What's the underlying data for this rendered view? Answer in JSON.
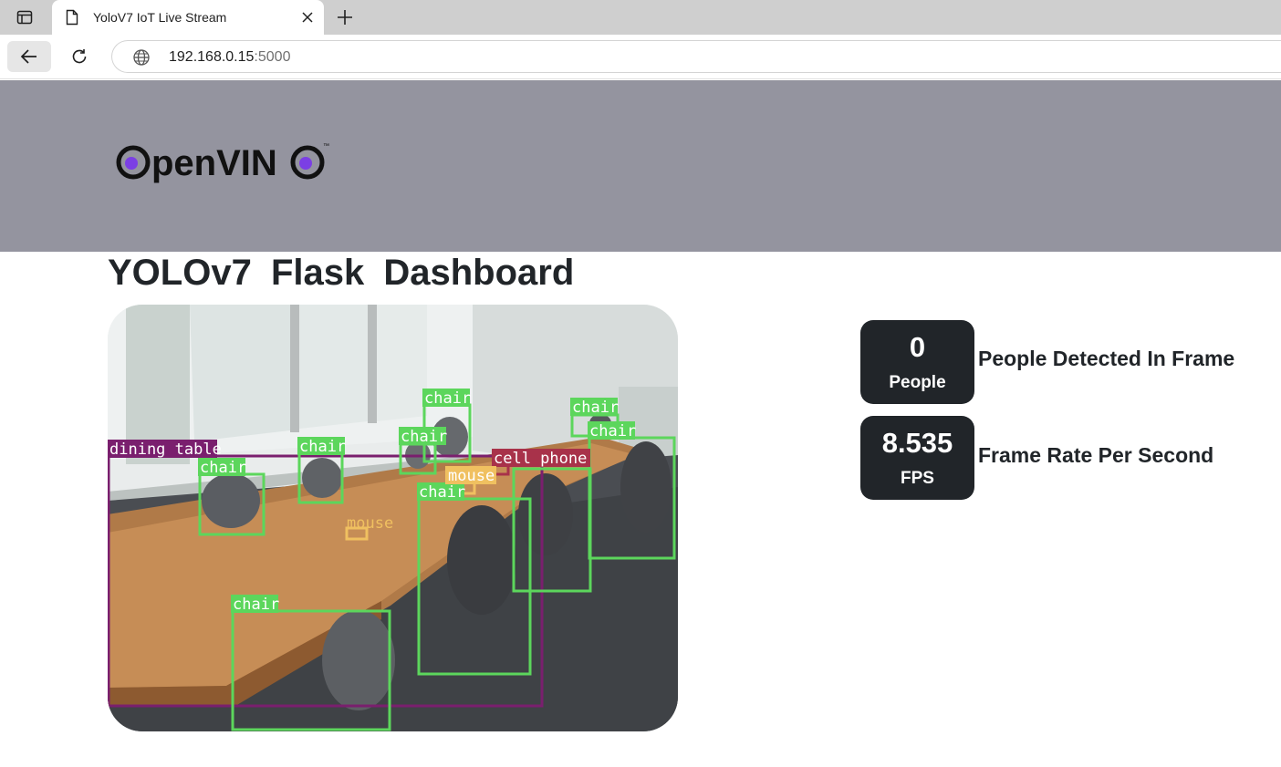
{
  "browser": {
    "tab_title": "YoloV7 IoT Live Stream",
    "url_host": "192.168.0.15",
    "url_port": ":5000"
  },
  "header": {
    "logo_text": "OpenVINO",
    "logo_trademark": "™",
    "band_color": "#94949f",
    "accent_color": "#7b3fe4"
  },
  "dashboard": {
    "title": "YOLOv7  Flask  Dashboard"
  },
  "stream": {
    "detections": [
      {
        "label": "dining table",
        "color": "#7a1f6e"
      },
      {
        "label": "chair",
        "color": "#5cd65c"
      },
      {
        "label": "chair",
        "color": "#5cd65c"
      },
      {
        "label": "chair",
        "color": "#5cd65c"
      },
      {
        "label": "chair",
        "color": "#5cd65c"
      },
      {
        "label": "chair",
        "color": "#5cd65c"
      },
      {
        "label": "chair",
        "color": "#5cd65c"
      },
      {
        "label": "chair",
        "color": "#5cd65c"
      },
      {
        "label": "chair",
        "color": "#5cd65c"
      },
      {
        "label": "cell phone",
        "color": "#a8324a"
      },
      {
        "label": "mouse",
        "color": "#f0c060"
      },
      {
        "label": "mouse",
        "color": "#f0c060"
      }
    ]
  },
  "stats": {
    "people": {
      "value": "0",
      "unit": "People",
      "label": "People Detected In Frame"
    },
    "fps": {
      "value": "8.535",
      "unit": "FPS",
      "label": "Frame Rate Per Second"
    }
  }
}
